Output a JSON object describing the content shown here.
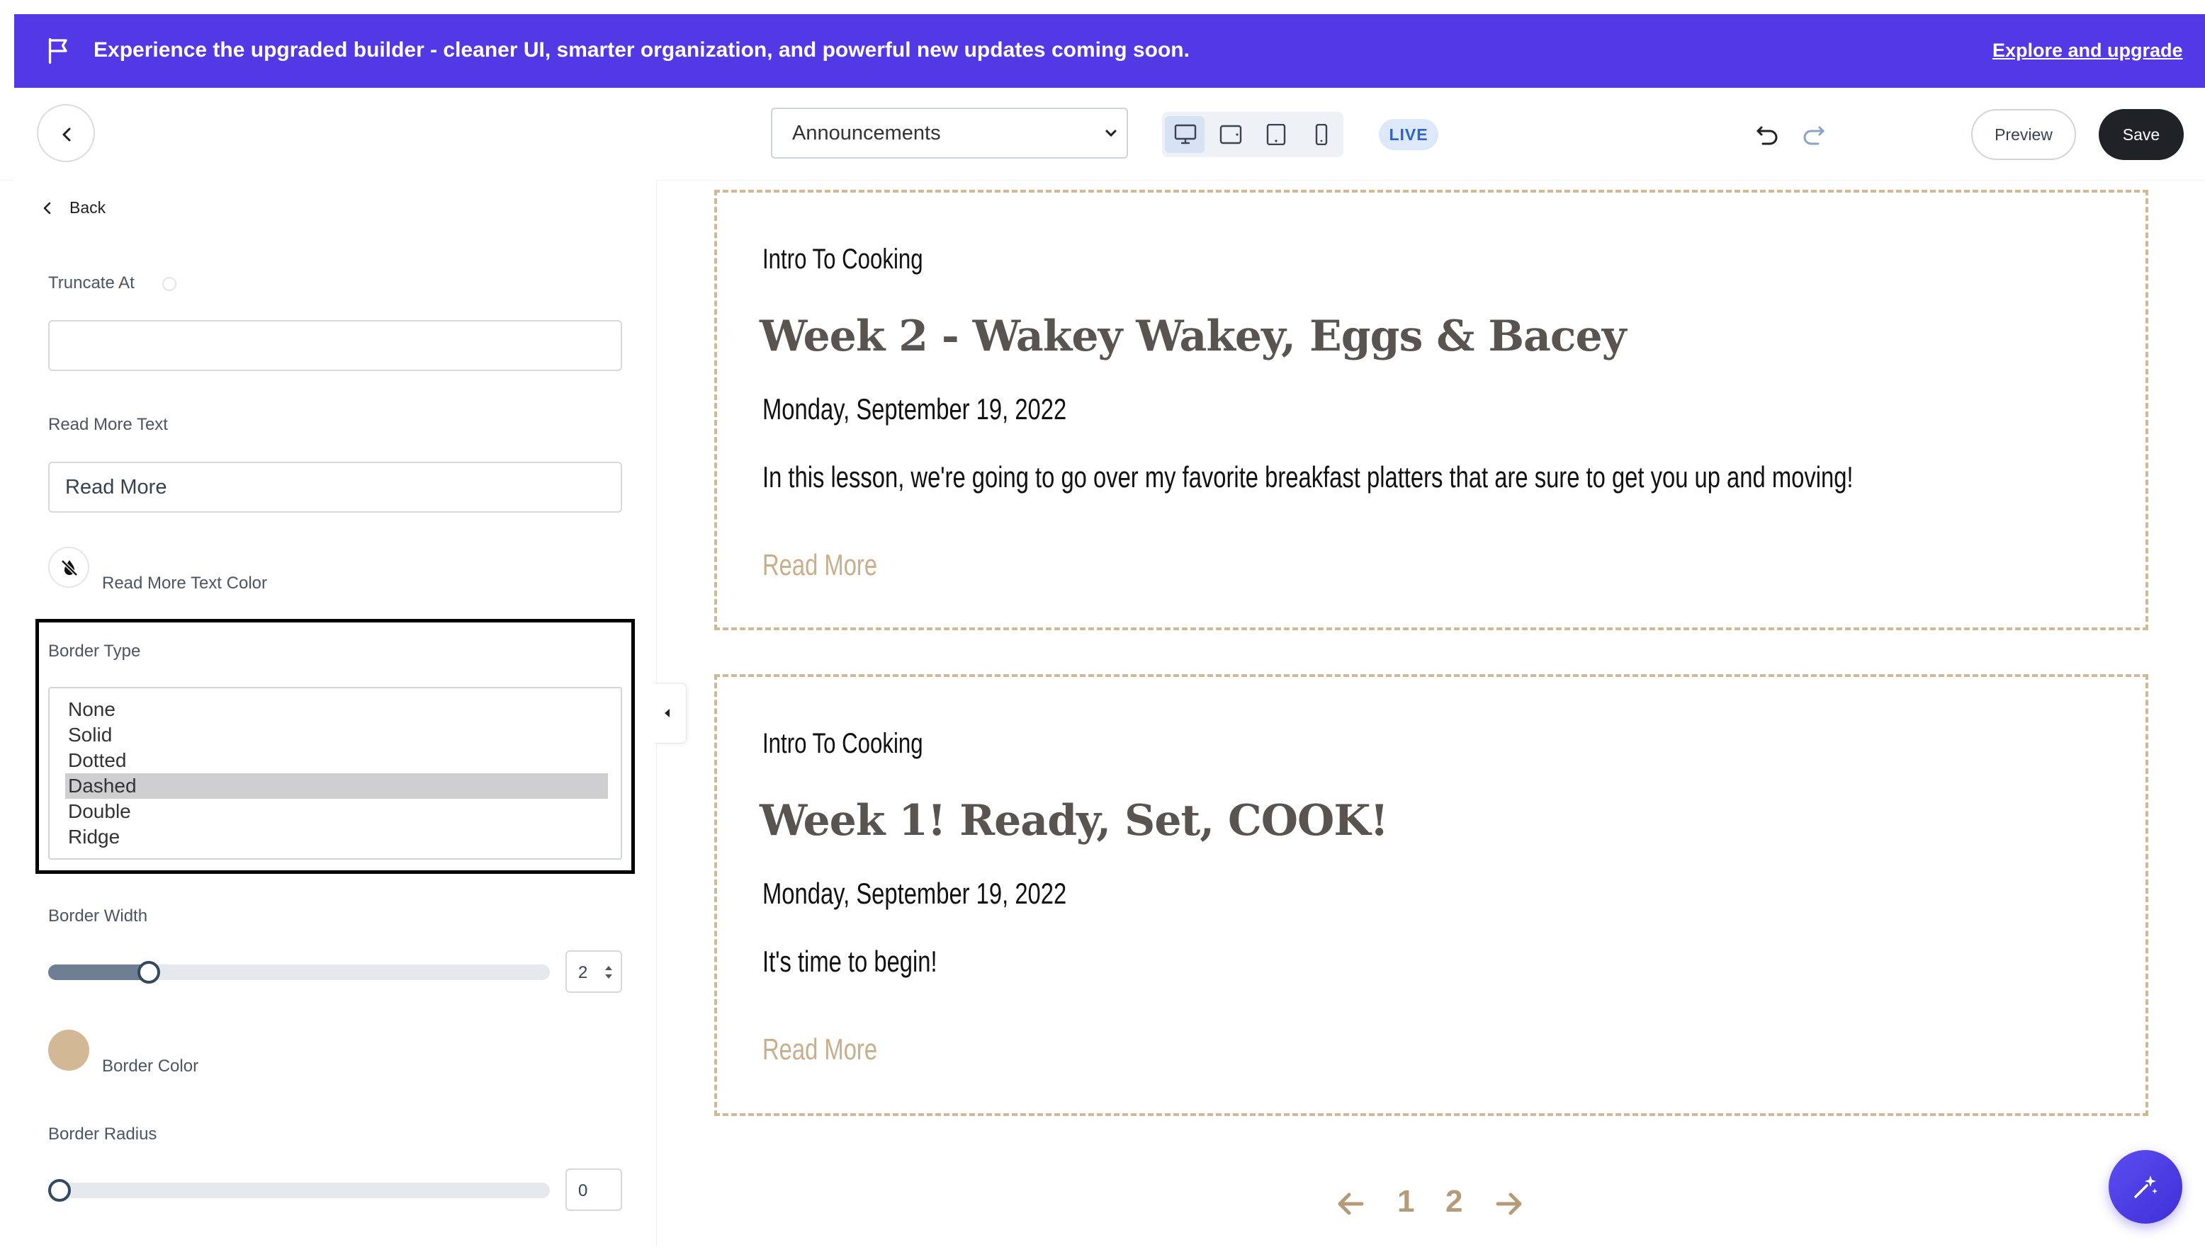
{
  "banner": {
    "message": "Experience the upgraded builder - cleaner UI, smarter organization, and powerful new updates coming soon.",
    "link": "Explore and upgrade",
    "background": "#5339e5"
  },
  "topbar": {
    "page_select": "Announcements",
    "devices": [
      "desktop-icon",
      "tablet-landscape-icon",
      "tablet-icon",
      "mobile-icon"
    ],
    "active_device": "desktop",
    "live_badge": "LIVE",
    "preview_label": "Preview",
    "save_label": "Save"
  },
  "panel": {
    "back_label": "Back",
    "truncate_label": "Truncate At",
    "truncate_value": "",
    "read_more_text_label": "Read More Text",
    "read_more_text_value": "Read More",
    "read_more_color_label": "Read More Text Color",
    "border_type_label": "Border Type",
    "border_type_options": [
      "None",
      "Solid",
      "Dotted",
      "Dashed",
      "Double",
      "Ridge"
    ],
    "border_type_selected": "Dashed",
    "border_width_label": "Border Width",
    "border_width_value": "2",
    "border_width_fraction": 0.2,
    "border_color_label": "Border Color",
    "border_color": "#d2b895",
    "border_radius_label": "Border Radius",
    "border_radius_value": "0",
    "border_radius_fraction": 0.0
  },
  "posts": [
    {
      "course": "Intro To Cooking",
      "title": "Week 2 - Wakey Wakey, Eggs & Bacey",
      "date": "Monday, September 19, 2022",
      "body": "In this lesson, we're going to go over my favorite breakfast platters that are sure to get you up and moving!",
      "read_more": "Read More"
    },
    {
      "course": "Intro To Cooking",
      "title": "Week 1! Ready, Set, COOK!",
      "date": "Monday, September 19, 2022",
      "body": "It's time to begin!",
      "read_more": "Read More"
    }
  ],
  "pagination": {
    "pages": [
      "1",
      "2"
    ],
    "prev_icon": "arrow-left-icon",
    "next_icon": "arrow-right-icon"
  },
  "colors": {
    "accent": "#5339e5",
    "read_more": "#c9ae8b",
    "title": "#5a5450"
  }
}
